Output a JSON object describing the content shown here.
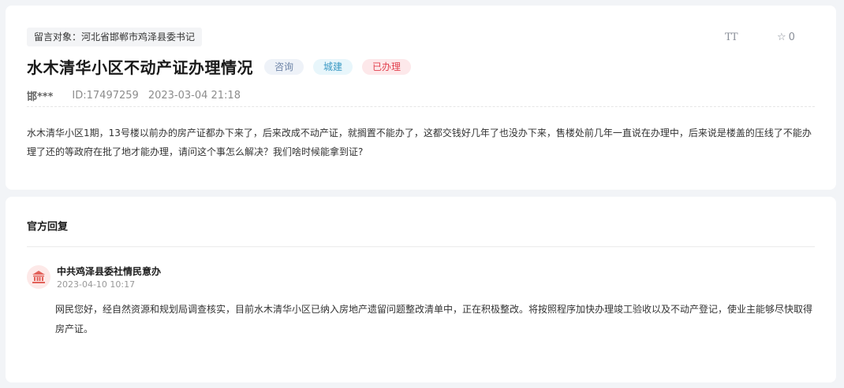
{
  "message": {
    "target_label": "留言对象：河北省邯郸市鸡泽县委书记",
    "title": "水木清华小区不动产证办理情况",
    "badges": {
      "consult": "咨询",
      "category": "城建",
      "status": "已办理"
    },
    "author": "邯***",
    "id_text": "ID:17497259",
    "time": "2023-03-04 21:18",
    "content": "水木清华小区1期，13号楼以前办的房产证都办下来了，后来改成不动产证，就搁置不能办了，这都交钱好几年了也没办下来，售楼处前几年一直说在办理中，后来说是楼盖的压线了不能办理了还的等政府在批了地才能办理，请问这个事怎么解决？我们啥时候能拿到证?"
  },
  "toolbar": {
    "font_size_label": "TT",
    "favorite_count": "0",
    "font_size_icon": "text-size-icon",
    "favorite_icon": "star-icon"
  },
  "reply": {
    "section_title": "官方回复",
    "org_name": "中共鸡泽县委社情民意办",
    "org_icon": "government-building-icon",
    "time": "2023-04-10 10:17",
    "content": "网民您好，经自然资源和规划局调查核实，目前水木清华小区已纳入房地产遗留问题整改清单中，正在积极整改。将按照程序加快办理竣工验收以及不动产登记，使业主能够尽快取得房产证。"
  },
  "colors": {
    "badge_consult": "#6f85a8",
    "badge_city": "#3c9ac4",
    "badge_done": "#e2414e",
    "org_icon": "#e2615a"
  }
}
